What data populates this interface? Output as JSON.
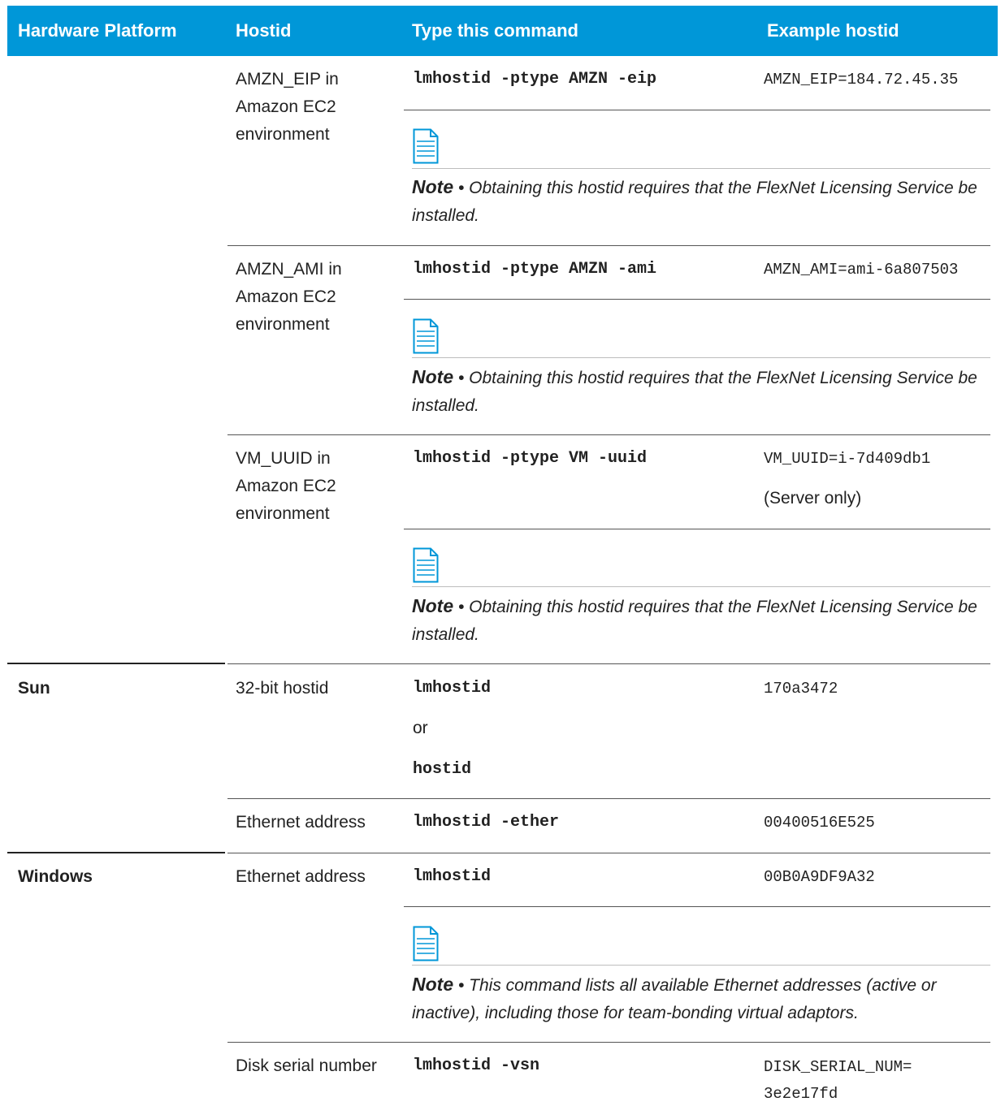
{
  "headers": {
    "platform": "Hardware Platform",
    "hostid": "Hostid",
    "command": "Type this command",
    "example": "Example hostid"
  },
  "rows": [
    {
      "hostid": "AMZN_EIP in Amazon EC2 environment",
      "command": "lmhostid -ptype AMZN -eip",
      "example": "AMZN_EIP=184.72.45.35",
      "note_label": "Note",
      "note_sep": "•",
      "note_text": "Obtaining this hostid requires that the FlexNet Licensing Service be installed."
    },
    {
      "hostid": "AMZN_AMI in Amazon EC2 environment",
      "command": "lmhostid -ptype AMZN -ami",
      "example": "AMZN_AMI=ami-6a807503",
      "note_label": "Note",
      "note_sep": "•",
      "note_text": "Obtaining this hostid requires that the FlexNet Licensing Service be installed."
    },
    {
      "hostid": "VM_UUID in Amazon EC2 environment",
      "command": "lmhostid -ptype VM -uuid",
      "example": "VM_UUID=i-7d409db1",
      "example_extra": "(Server only)",
      "note_label": "Note",
      "note_sep": "•",
      "note_text": "Obtaining this hostid requires that the FlexNet Licensing Service be installed."
    },
    {
      "platform": "Sun",
      "hostid": "32-bit hostid",
      "command": "lmhostid",
      "or": "or",
      "command_alt": "hostid",
      "example": "170a3472"
    },
    {
      "hostid": "Ethernet address",
      "command": "lmhostid -ether",
      "example": "00400516E525"
    },
    {
      "platform": "Windows",
      "hostid": "Ethernet address",
      "command": "lmhostid",
      "example": "00B0A9DF9A32",
      "note_label": "Note",
      "note_sep": "•",
      "note_text": "This command lists all available Ethernet addresses (active or inactive), including those for team-bonding virtual adaptors."
    },
    {
      "hostid": "Disk serial number",
      "command": "lmhostid -vsn",
      "example": "DISK_SERIAL_NUM= 3e2e17fd"
    }
  ],
  "note_icon": "note-document-icon",
  "colors": {
    "header_bg": "#0097d8",
    "header_text": "#ffffff",
    "icon": "#0097d8"
  }
}
